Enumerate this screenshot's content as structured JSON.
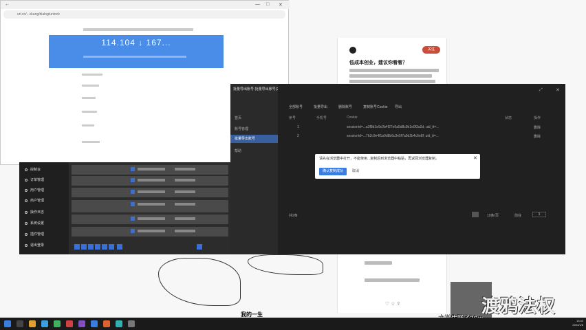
{
  "browser": {
    "url": "url.cn/...xkang/dialog/unlock",
    "speed_banner": {
      "value": "114.104 ↓ 167..."
    },
    "window_controls": {
      "minimize": "—",
      "maximize": "□",
      "close": "✕"
    }
  },
  "article": {
    "follow_label": "关注",
    "title": "低成本创业，建议你看看？"
  },
  "admin": {
    "sidebar": [
      {
        "label": "控制台"
      },
      {
        "label": "订单管理"
      },
      {
        "label": "用户管理"
      },
      {
        "label": "商户管理"
      },
      {
        "label": "操作日志"
      },
      {
        "label": "系统设置"
      },
      {
        "label": "插件管理"
      },
      {
        "label": "退出登录"
      }
    ]
  },
  "dialog": {
    "title": "批量导出账号-批量导出账号(2/2)",
    "side_items": [
      {
        "label": "首页"
      },
      {
        "label": "账号管理"
      },
      {
        "label": "批量导出账号"
      },
      {
        "label": "帮助"
      }
    ],
    "tabs": [
      "全部账号",
      "批量导出",
      "删除账号",
      "复制账号Cookie",
      "导出"
    ],
    "columns": [
      "序号",
      "手机号",
      "Cookie",
      "状态",
      "操作"
    ],
    "rows": [
      {
        "index": "1",
        "cookie": "sessionid=...a3f8d1e9c0b4f27e6a5d8c9b1e0f3a2d; uid_tt=...",
        "action": "删除"
      },
      {
        "index": "2",
        "cookie": "sessionid=...7b2c9e4f1a0d8b6c3e5f7a9d2b4c6e8f; uid_tt=...",
        "action": "删除"
      }
    ],
    "notice": {
      "text": "请先在浏览器中打开，不能使用...复制后到浏览器中粘贴，再返回浏览器复制。",
      "ok": "确认复制成功",
      "cancel": "取消",
      "close": "✕"
    },
    "footer": {
      "total": "共2条",
      "page_size": "10条/页",
      "goto": "前往",
      "page": "1"
    }
  },
  "overlay": {
    "watermark": "渡鸦法权",
    "caption": "大学生赚了30w",
    "bottom_caption": "我的一生"
  },
  "taskbar": {
    "time": "13:43",
    "date": "2024/1/8"
  },
  "colors": {
    "accent_blue": "#3a7de0",
    "follow_red": "#c84e3b",
    "dark_bg": "#202020"
  }
}
